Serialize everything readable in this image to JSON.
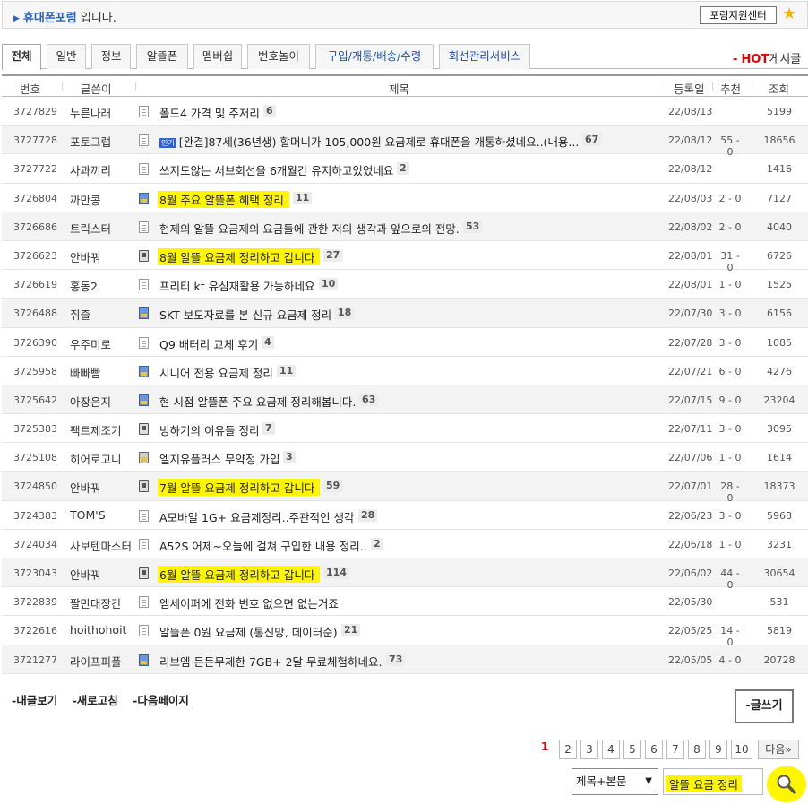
{
  "header": {
    "forum_name": "휴대폰포럼",
    "suffix": "입니다.",
    "support_button": "포럼지원센터"
  },
  "tabs": [
    {
      "label": "전체"
    },
    {
      "label": "일반"
    },
    {
      "label": "정보"
    },
    {
      "label": "알뜰폰"
    },
    {
      "label": "멤버쉽"
    },
    {
      "label": "번호놀이"
    },
    {
      "label": "구입/개통/배송/수령"
    },
    {
      "label": "회선관리서비스"
    }
  ],
  "hot": {
    "dash": "-",
    "hot": "HOT",
    "board": "게시글"
  },
  "columns": {
    "num": "번호",
    "author": "글쓴이",
    "title": "제목",
    "date": "등록일",
    "rec": "추천",
    "views": "조회"
  },
  "rows": [
    {
      "num": "3727829",
      "author": "누른나래",
      "title": "폴드4 가격 및 주저리",
      "comments": "6",
      "date": "22/08/13",
      "rec": "",
      "views": "5199",
      "icon": "doc-icon",
      "badge": ""
    },
    {
      "num": "3727728",
      "author": "포토그랩",
      "title": "[완결]87세(36년생) 할머니가 105,000원 요금제로 휴대폰을 개통하셨네요..(내용...",
      "comments": "67",
      "date": "22/08/12",
      "rec": "55 - 0",
      "views": "18656",
      "icon": "doc-icon",
      "badge": "인기"
    },
    {
      "num": "3727722",
      "author": "사과끼리",
      "title": "쓰지도않는 서브회선을 6개월간 유지하고있었네요",
      "comments": "2",
      "date": "22/08/12",
      "rec": "",
      "views": "1416",
      "icon": "doc-icon",
      "badge": ""
    },
    {
      "num": "3726804",
      "author": "까만콩",
      "title": "8월 주요 알뜰폰 혜택 정리",
      "comments": "11",
      "date": "22/08/03",
      "rec": "2 - 0",
      "views": "7127",
      "icon": "image-icon",
      "badge": ""
    },
    {
      "num": "3726686",
      "author": "트릭스터",
      "title": "현제의 알뜰 요금제의 요금들에 관한 저의 생각과 앞으로의 전망.",
      "comments": "53",
      "date": "22/08/02",
      "rec": "2 - 0",
      "views": "4040",
      "icon": "doc-icon",
      "badge": ""
    },
    {
      "num": "3726623",
      "author": "안바꿔",
      "title": "8월 알뜰 요금제 정리하고 갑니다",
      "comments": "27",
      "date": "22/08/01",
      "rec": "31 - 0",
      "views": "6726",
      "icon": "phone-icon",
      "badge": ""
    },
    {
      "num": "3726619",
      "author": "홍동2",
      "title": "프리티 kt 유심재활용 가능하네요",
      "comments": "10",
      "date": "22/08/01",
      "rec": "1 - 0",
      "views": "1525",
      "icon": "doc-icon",
      "badge": ""
    },
    {
      "num": "3726488",
      "author": "쥐즐",
      "title": "SKT 보도자료를 본 신규 요금제 정리",
      "comments": "18",
      "date": "22/07/30",
      "rec": "3 - 0",
      "views": "6156",
      "icon": "image-icon",
      "badge": ""
    },
    {
      "num": "3726390",
      "author": "우주미로",
      "title": "Q9 배터리 교체 후기",
      "comments": "4",
      "date": "22/07/28",
      "rec": "3 - 0",
      "views": "1085",
      "icon": "doc-icon",
      "badge": ""
    },
    {
      "num": "3725958",
      "author": "빠빠빰",
      "title": "시니어 전용 요금제 정리",
      "comments": "11",
      "date": "22/07/21",
      "rec": "6 - 0",
      "views": "4276",
      "icon": "image-icon",
      "badge": ""
    },
    {
      "num": "3725642",
      "author": "아장은지",
      "title": "현 시점 알뜰폰 주요 요금제 정리해봅니다.",
      "comments": "63",
      "date": "22/07/15",
      "rec": "9 - 0",
      "views": "23204",
      "icon": "image-icon",
      "badge": ""
    },
    {
      "num": "3725383",
      "author": "팩트제조기",
      "title": "빙하기의 이유들 정리",
      "comments": "7",
      "date": "22/07/11",
      "rec": "3 - 0",
      "views": "3095",
      "icon": "phone-icon",
      "badge": ""
    },
    {
      "num": "3725108",
      "author": "히어로고니",
      "title": "엘지유플러스 무약정 가입",
      "comments": "3",
      "date": "22/07/06",
      "rec": "1 - 0",
      "views": "1614",
      "icon": "image2-icon",
      "badge": ""
    },
    {
      "num": "3724850",
      "author": "안바꿔",
      "title": "7월 알뜰 요금제 정리하고 갑니다",
      "comments": "59",
      "date": "22/07/01",
      "rec": "28 - 0",
      "views": "18373",
      "icon": "phone-icon",
      "badge": ""
    },
    {
      "num": "3724383",
      "author": "TOM'S",
      "title": "A모바일 1G+ 요금제정리..주관적인 생각",
      "comments": "28",
      "date": "22/06/23",
      "rec": "3 - 0",
      "views": "5968",
      "icon": "doc-icon",
      "badge": ""
    },
    {
      "num": "3724034",
      "author": "사보텐마스터",
      "title": "A52S 어제~오늘에 걸쳐 구입한 내용 정리..",
      "comments": "2",
      "date": "22/06/18",
      "rec": "1 - 0",
      "views": "3231",
      "icon": "doc-icon",
      "badge": ""
    },
    {
      "num": "3723043",
      "author": "안바꿔",
      "title": "6월 알뜰 요금제 정리하고 갑니다",
      "comments": "114",
      "date": "22/06/02",
      "rec": "44 - 0",
      "views": "30654",
      "icon": "phone-icon",
      "badge": ""
    },
    {
      "num": "3722839",
      "author": "팔만대장간",
      "title": "엠세이퍼에 전화 번호 없으면 없는거죠",
      "comments": "",
      "date": "22/05/30",
      "rec": "",
      "views": "531",
      "icon": "doc-icon",
      "badge": ""
    },
    {
      "num": "3722616",
      "author": "hoithohoit",
      "title": "알뜰폰 0원 요금제 (통신망, 데이터순)",
      "comments": "21",
      "date": "22/05/25",
      "rec": "14 - 0",
      "views": "5819",
      "icon": "doc-icon",
      "badge": ""
    },
    {
      "num": "3721277",
      "author": "라이프피플",
      "title": "리브엠 든든무제한 7GB+ 2달 무료체험하네요.",
      "comments": "73",
      "date": "22/05/05",
      "rec": "4 - 0",
      "views": "20728",
      "icon": "image-icon",
      "badge": ""
    }
  ],
  "bottom_links": [
    "-내글보기",
    "-새로고침",
    "-다음페이지"
  ],
  "write_button": "-글쓰기",
  "pagination": {
    "current": "1",
    "pages": [
      "2",
      "3",
      "4",
      "5",
      "6",
      "7",
      "8",
      "9",
      "10"
    ],
    "next": "다음»"
  },
  "search": {
    "scope": "제목+본문",
    "query": "알뜰 요금 정리"
  },
  "colors": {
    "accent_blue": "#2a63b8",
    "hot_red": "#e00000",
    "highlight": "#fdf600"
  }
}
